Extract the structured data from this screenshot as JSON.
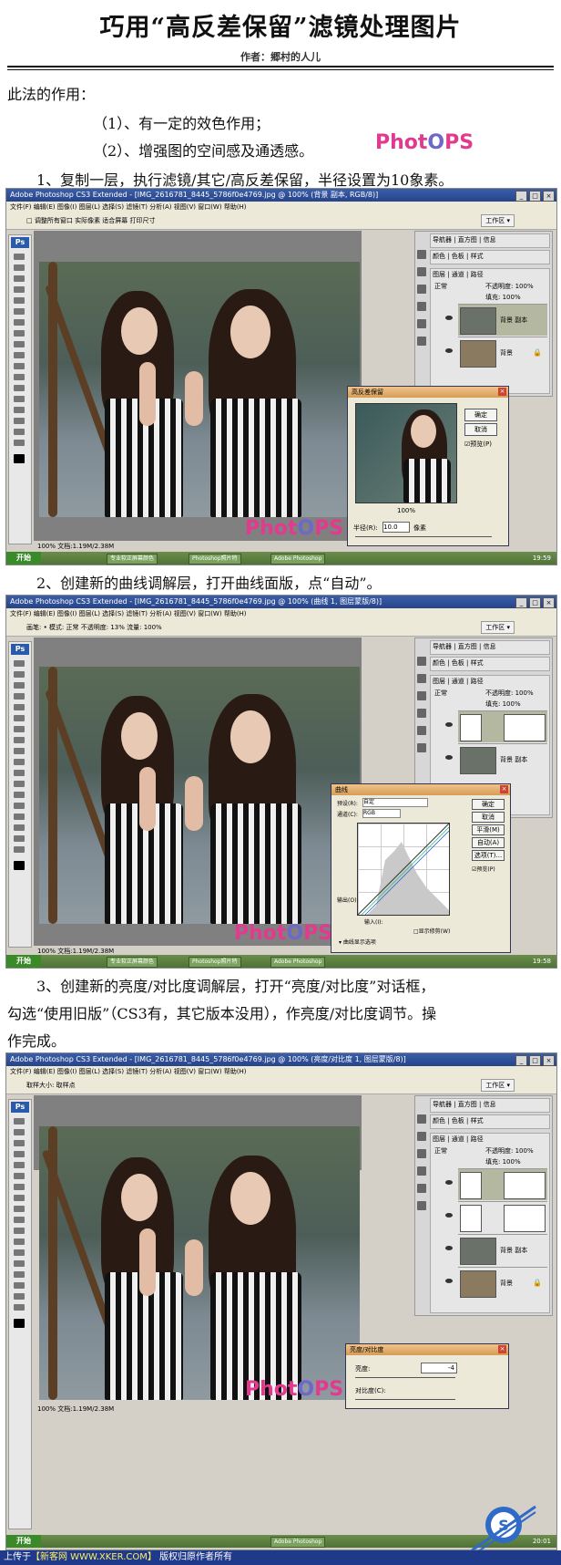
{
  "title": "巧用“高反差保留”滤镜处理图片",
  "author": "作者：郷村的人儿",
  "intro": {
    "heading": "此法的作用：",
    "point1": "（1）、有一定的效色作用；",
    "point2": "（2）、增强图的空间感及通透感。"
  },
  "steps": [
    {
      "text": "1、复制一层，执行滤镜/其它/高反差保留，半径设置为10象素。"
    },
    {
      "text": "2、创建新的曲线调解层，打开曲线面版，点“自动”。"
    },
    {
      "line1": "3、创建新的亮度/对比度调解层，打开“亮度/对比度”对话框，",
      "line2": "勾选“使用旧版”（CS3有，其它版本没用），作亮度/对比度调节。操",
      "line3": "作完成。"
    }
  ],
  "logo": {
    "part1": "Phot",
    "o": "O",
    "part2": "PS"
  },
  "shots": [
    {
      "titlebar": "Adobe Photoshop CS3 Extended - [IMG_2616781_8445_5786f0e4769.jpg @ 100% (背景 副本, RGB/8)]",
      "menu": "文件(F)  编辑(E)  图像(I)  图层(L)  选择(S)  滤镜(T)  分析(A)  视图(V)  窗口(W)  帮助(H)",
      "options": "□ 调整所有窗口    实际像素    适合屏幕    打印尺寸",
      "workspace": "工作区 ▾",
      "panel_tabs1": "导航器 | 直方图 | 信息",
      "panel_tabs2": "颜色 | 色板 | 样式",
      "panel_tabs3": "图层 | 通道 | 路径",
      "blend": "正常",
      "opacity": "不透明度: 100%",
      "fill": "填充: 100%",
      "layers": [
        "背景 副本",
        "背景"
      ],
      "status": "100%      文档:1.19M/2.38M",
      "dialog": {
        "title": "高反差保留",
        "ok": "确定",
        "cancel": "取消",
        "preview": "☑预览(P)",
        "zoom": "100%",
        "radius_label": "半径(R):",
        "radius_value": "10.0",
        "unit": "像素"
      },
      "taskbar": {
        "start": "开始",
        "items": [
          "专业软正屏幕颜色",
          "Photoshop照片特",
          "Adobe Photoshop"
        ],
        "clock": "19:59"
      }
    },
    {
      "titlebar": "Adobe Photoshop CS3 Extended - [IMG_2616781_8445_5786f0e4769.jpg @ 100% (曲线 1, 图层蒙版/8)]",
      "menu": "文件(F)  编辑(E)  图像(I)  图层(L)  选择(S)  滤镜(T)  分析(A)  视图(V)  窗口(W)  帮助(H)",
      "options": "画笔:  •  模式: 正常        不透明度: 13%      流量: 100%",
      "workspace": "工作区 ▾",
      "panel_tabs1": "导航器 | 直方图 | 信息",
      "panel_tabs2": "颜色 | 色板 | 样式",
      "panel_tabs3": "图层 | 通道 | 路径",
      "blend": "正常",
      "opacity": "不透明度: 100%",
      "fill": "填充: 100%",
      "layers": [
        "",
        "背景 副本"
      ],
      "status": "100%      文档:1.19M/2.38M",
      "dialog": {
        "title": "曲线",
        "preset_label": "预设(R):",
        "preset_value": "自定",
        "channel_label": "通道(C):",
        "channel_value": "RGB",
        "ok": "确定",
        "cancel": "取消",
        "smooth": "平滑(M)",
        "auto": "自动(A)",
        "options": "选项(T)...",
        "preview": "☑预览(P)",
        "output": "输出(O):",
        "input": "输入(I):",
        "show_clip": "□显示修剪(W)",
        "curve_options": "▾ 曲线显示选项"
      },
      "taskbar": {
        "start": "开始",
        "items": [
          "专业软正屏幕颜色",
          "Photoshop照片特",
          "Adobe Photoshop"
        ],
        "clock": "19:58"
      }
    },
    {
      "titlebar": "Adobe Photoshop CS3 Extended - [IMG_2616781_8445_5786f0e4769.jpg @ 100% (亮度/对比度 1, 图层蒙版/8)]",
      "menu": "文件(F)  编辑(E)  图像(I)  图层(L)  选择(S)  滤镜(T)  分析(A)  视图(V)  窗口(W)  帮助(H)",
      "options": "取样大小:  取样点",
      "workspace": "工作区 ▾",
      "panel_tabs1": "导航器 | 直方图 | 信息",
      "panel_tabs2": "颜色 | 色板 | 样式",
      "panel_tabs3": "图层 | 通道 | 路径",
      "blend": "正常",
      "opacity": "不透明度: 100%",
      "fill": "填充: 100%",
      "layers": [
        "",
        "",
        "背景 副本",
        "背景"
      ],
      "status": "100%      文档:1.19M/2.38M",
      "dialog": {
        "title": "亮度/对比度",
        "brightness_label": "亮度:",
        "brightness_value": "-4",
        "contrast_label": "对比度(C):"
      },
      "taskbar": {
        "start": "开始",
        "items": [
          "",
          "",
          "Adobe Photoshop"
        ],
        "clock": "20:01"
      }
    }
  ],
  "footer": {
    "prefix": "上传于",
    "site": "【新客网 WWW.XKER.COM】",
    "suffix": "版权归原作者所有"
  },
  "colors": {
    "accent_pink": "#e23a8e",
    "accent_purple": "#6e68c8",
    "footer_bg": "#1f3a8a"
  }
}
